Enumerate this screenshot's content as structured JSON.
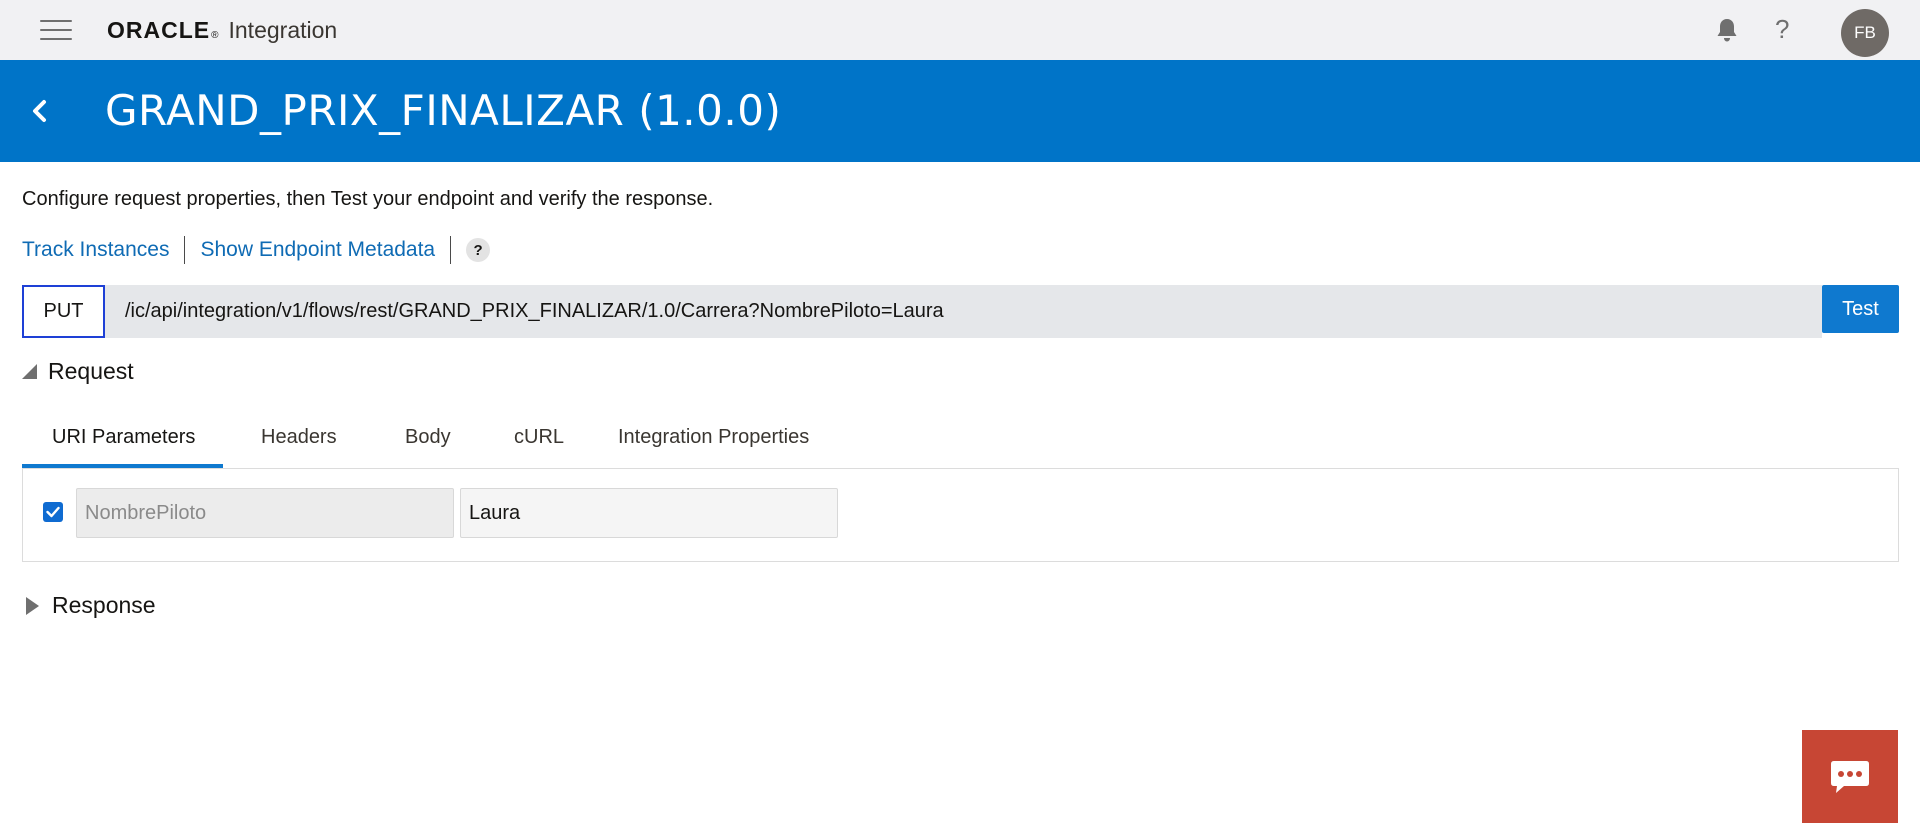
{
  "header": {
    "brand_logo": "ORACLE",
    "brand_reg": "®",
    "brand_product": "Integration",
    "help_label": "?",
    "avatar_initials": "FB"
  },
  "titlebar": {
    "title": "GRAND_PRIX_FINALIZAR (1.0.0)"
  },
  "intro_text": "Configure request properties, then Test your endpoint and verify the response.",
  "links": {
    "track_instances": "Track Instances",
    "show_metadata": "Show Endpoint Metadata",
    "help": "?"
  },
  "endpoint": {
    "method": "PUT",
    "url": "/ic/api/integration/v1/flows/rest/GRAND_PRIX_FINALIZAR/1.0/Carrera?NombrePiloto=Laura",
    "test_label": "Test"
  },
  "request_section": {
    "label": "Request",
    "expanded": true
  },
  "tabs": [
    {
      "label": "URI Parameters",
      "active": true
    },
    {
      "label": "Headers",
      "active": false
    },
    {
      "label": "Body",
      "active": false
    },
    {
      "label": "cURL",
      "active": false
    },
    {
      "label": "Integration Properties",
      "active": false
    }
  ],
  "params": [
    {
      "checked": true,
      "name": "NombrePiloto",
      "value": "Laura"
    }
  ],
  "response_section": {
    "label": "Response",
    "expanded": false
  },
  "colors": {
    "title_band": "#0074c8",
    "link": "#0f6bb4",
    "test_button": "#0f79cf",
    "chat_button": "#c74634",
    "method_border": "#1e40d6"
  }
}
